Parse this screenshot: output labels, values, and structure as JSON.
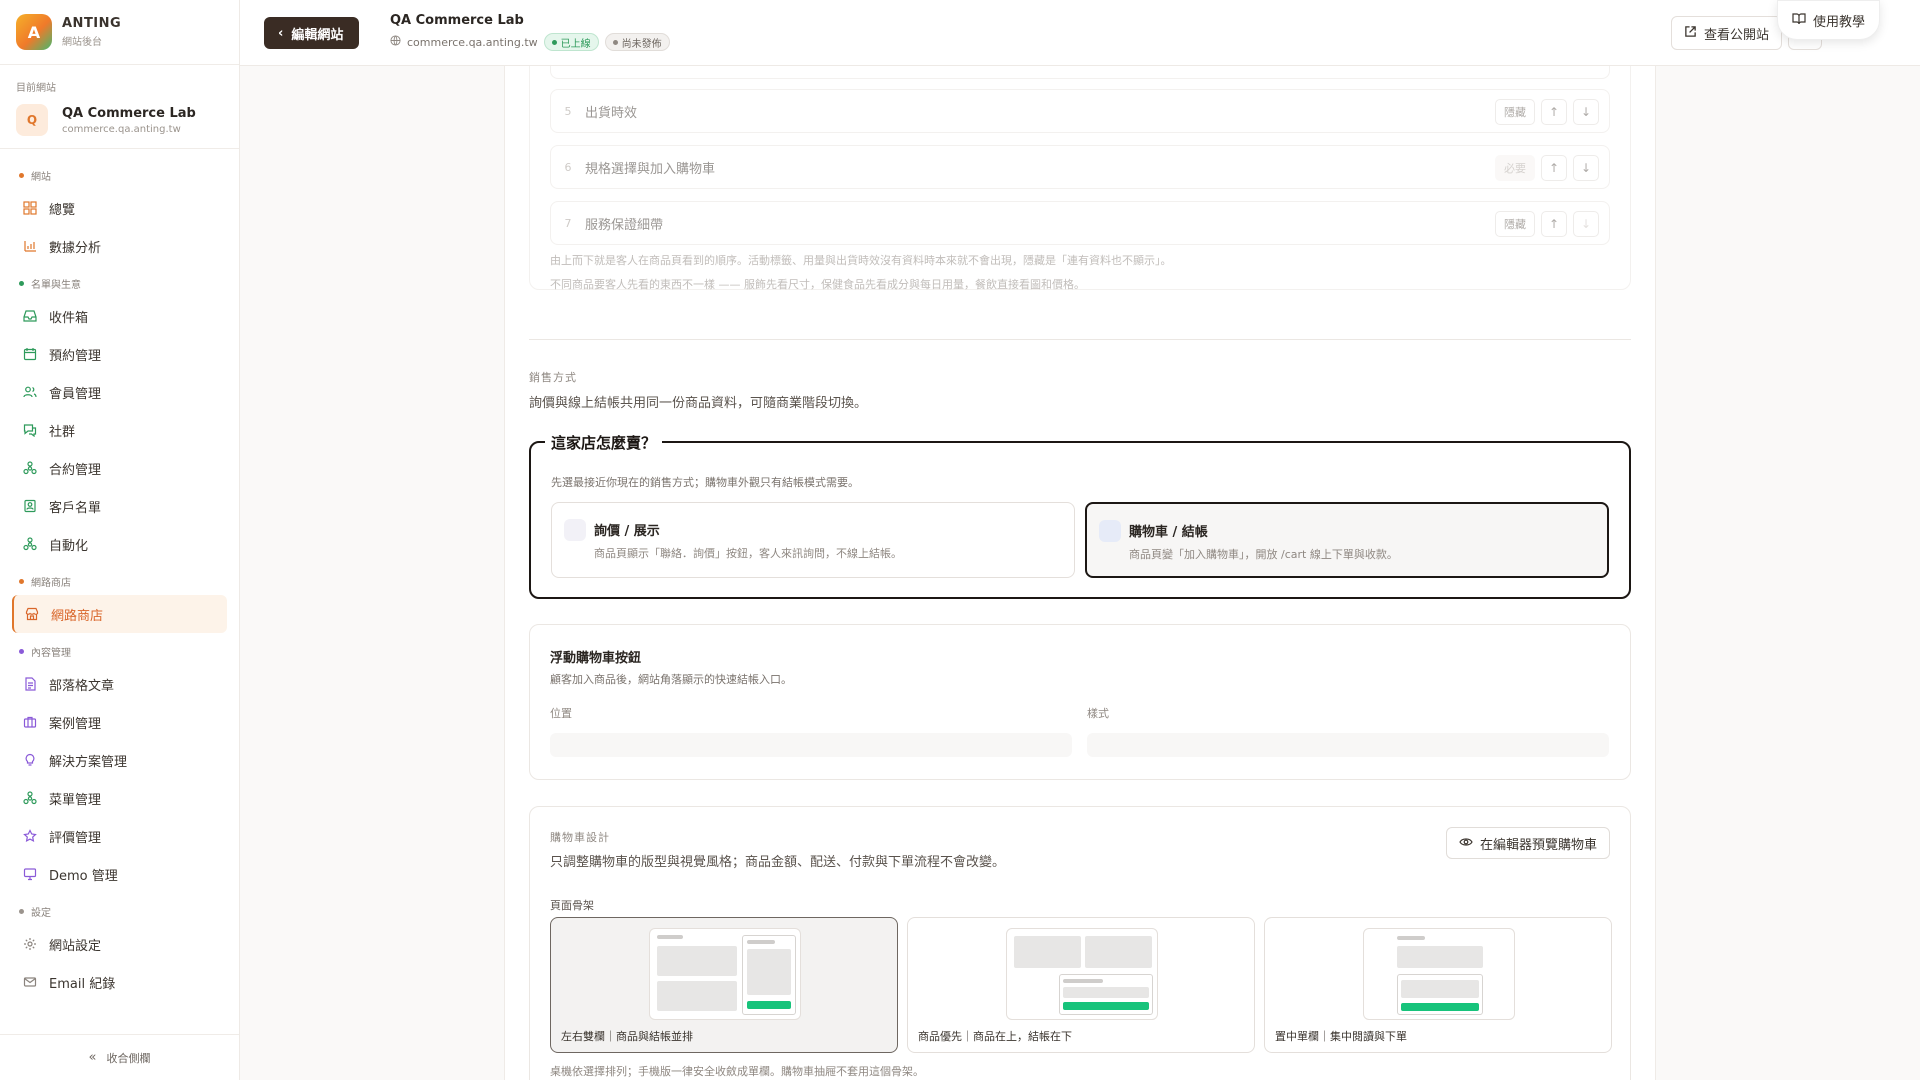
{
  "brand": {
    "logo_letter": "A",
    "name": "ANTING",
    "subtitle": "網站後台"
  },
  "current_site": {
    "label": "目前網站",
    "avatar_letter": "Q",
    "name": "QA Commerce Lab",
    "domain": "commerce.qa.anting.tw"
  },
  "nav": {
    "groups": [
      {
        "label": "網站",
        "color": "#e0772c",
        "items": [
          {
            "label": "總覽",
            "icon": "grid-icon"
          },
          {
            "label": "數據分析",
            "icon": "chart-icon"
          }
        ]
      },
      {
        "label": "名單與生意",
        "color": "#2e9a5b",
        "items": [
          {
            "label": "收件箱",
            "icon": "inbox-icon"
          },
          {
            "label": "預約管理",
            "icon": "calendar-icon"
          },
          {
            "label": "會員管理",
            "icon": "users-icon"
          },
          {
            "label": "社群",
            "icon": "chat-icon"
          },
          {
            "label": "合約管理",
            "icon": "nodes-icon"
          },
          {
            "label": "客戶名單",
            "icon": "contact-icon"
          },
          {
            "label": "自動化",
            "icon": "nodes-icon"
          }
        ]
      },
      {
        "label": "網路商店",
        "color": "#e0772c",
        "items": [
          {
            "label": "網路商店",
            "icon": "store-icon",
            "active": true
          }
        ]
      },
      {
        "label": "內容管理",
        "color": "#8a5ad8",
        "items": [
          {
            "label": "部落格文章",
            "icon": "doc-icon"
          },
          {
            "label": "案例管理",
            "icon": "briefcase-icon"
          },
          {
            "label": "解決方案管理",
            "icon": "bulb-icon"
          },
          {
            "label": "菜單管理",
            "icon": "nodes-icon"
          },
          {
            "label": "評價管理",
            "icon": "star-icon"
          },
          {
            "label": "Demo 管理",
            "icon": "monitor-icon"
          }
        ]
      },
      {
        "label": "設定",
        "color": "#9b948d",
        "items": [
          {
            "label": "網站設定",
            "icon": "gear-icon"
          },
          {
            "label": "Email 紀錄",
            "icon": "mail-icon"
          }
        ]
      }
    ],
    "collapse_label": "收合側欄"
  },
  "topbar": {
    "edit_button": "編輯網站",
    "project_title": "QA Commerce Lab",
    "project_domain": "commerce.qa.anting.tw",
    "status_live": "已上線",
    "status_unpublished": "尚未發佈",
    "view_site": "查看公開站",
    "tutorial": "使用教學"
  },
  "order": {
    "rows": [
      {
        "num": "5",
        "label": "出貨時效",
        "action": "隱藏",
        "down_enabled": true
      },
      {
        "num": "6",
        "label": "規格選擇與加入購物車",
        "action": "必要",
        "required": true,
        "down_enabled": true
      },
      {
        "num": "7",
        "label": "服務保證細帶",
        "action": "隱藏",
        "down_enabled": false
      }
    ],
    "hint1": "由上而下就是客人在商品頁看到的順序。活動標籤、用量與出貨時效沒有資料時本來就不會出現，隱藏是「連有資料也不顯示」。",
    "hint2": "不同商品要客人先看的東西不一樣 —— 服飾先看尺寸，保健食品先看成分與每日用量，餐飲直接看圖和價格。"
  },
  "sales": {
    "label": "銷售方式",
    "desc": "詢價與線上結帳共用同一份商品資料，可隨商業階段切換。",
    "question": "這家店怎麼賣？",
    "question_desc": "先選最接近你現在的銷售方式；購物車外觀只有結帳模式需要。",
    "options": [
      {
        "title": "詢價 / 展示",
        "desc": "商品頁顯示「聯絡．詢價」按鈕，客人來訊詢問，不線上結帳。",
        "selected": false
      },
      {
        "title": "購物車 / 結帳",
        "desc": "商品頁變「加入購物車」，開放 /cart 線上下單與收款。",
        "selected": true
      }
    ]
  },
  "floating_cart": {
    "title": "浮動購物車按鈕",
    "desc": "顧客加入商品後，網站角落顯示的快速結帳入口。",
    "position_label": "位置",
    "style_label": "樣式"
  },
  "cart_design": {
    "label": "購物車設計",
    "desc": "只調整購物車的版型與視覺風格；商品金額、配送、付款與下單流程不會改變。",
    "preview_button": "在編輯器預覽購物車",
    "layout_label": "頁面骨架",
    "layouts": [
      {
        "label": "左右雙欄｜商品與結帳並排",
        "selected": true
      },
      {
        "label": "商品優先｜商品在上，結帳在下",
        "selected": false
      },
      {
        "label": "置中單欄｜集中閱讀與下單",
        "selected": false
      }
    ],
    "bottom_hint": "桌機依選擇排列；手機版一律安全收斂成單欄。購物車抽屜不套用這個骨架。"
  },
  "colors": {
    "accent": "#e0772c",
    "dark": "#3a2c24",
    "success": "#17c37b"
  }
}
